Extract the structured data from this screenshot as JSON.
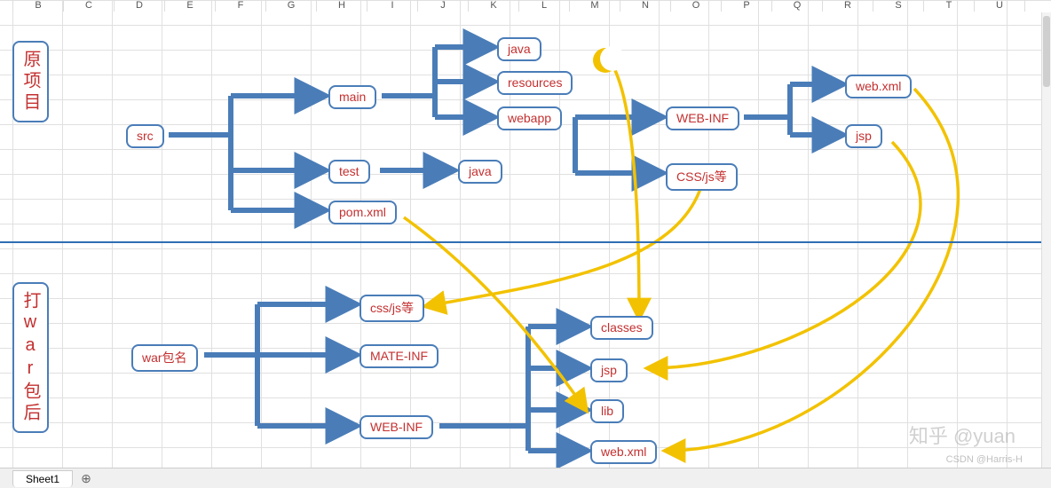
{
  "columns": [
    "B",
    "C",
    "D",
    "E",
    "F",
    "G",
    "H",
    "I",
    "J",
    "K",
    "L",
    "M",
    "N",
    "O",
    "P",
    "Q",
    "R",
    "S",
    "T",
    "U"
  ],
  "section_top_label": "原项目",
  "section_bottom_label": "打war包后",
  "top": {
    "src": "src",
    "main": "main",
    "test": "test",
    "pom": "pom.xml",
    "main_java": "java",
    "main_res": "resources",
    "main_webapp": "webapp",
    "test_java": "java",
    "webinf": "WEB-INF",
    "cssjs": "CSS/js等",
    "webxml": "web.xml",
    "jsp": "jsp"
  },
  "bottom": {
    "war": "war包名",
    "cssjs": "css/js等",
    "mateinf": "MATE-INF",
    "webinf": "WEB-INF",
    "classes": "classes",
    "jsp": "jsp",
    "lib": "lib",
    "webxml": "web.xml"
  },
  "sheet_tab": "Sheet1",
  "watermark_zh": "知乎 @yuan",
  "watermark_attr": "CSDN @Harris-H",
  "colors": {
    "connector": "#4a7db8",
    "curve": "#f2c200",
    "node_text": "#c43030"
  }
}
